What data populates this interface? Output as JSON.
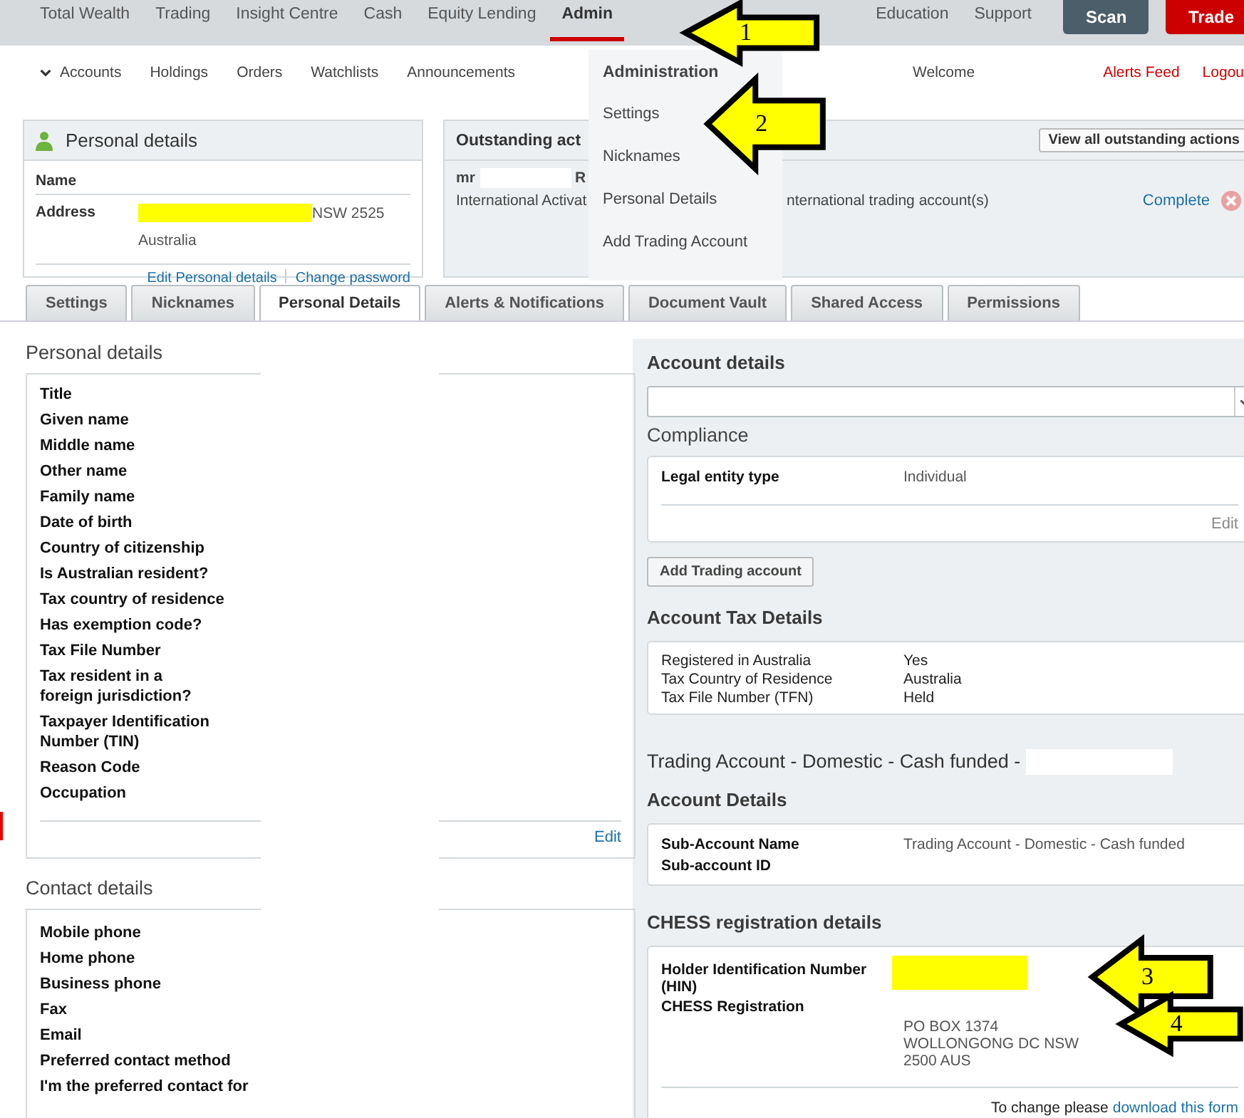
{
  "top_nav": {
    "items": [
      {
        "label": "Total Wealth",
        "selected": false
      },
      {
        "label": "Trading",
        "selected": false
      },
      {
        "label": "Insight Centre",
        "selected": false
      },
      {
        "label": "Cash",
        "selected": false
      },
      {
        "label": "Equity Lending",
        "selected": false
      },
      {
        "label": "Admin",
        "selected": true
      }
    ],
    "right_items": [
      "Education",
      "Support"
    ],
    "buttons": [
      {
        "label": "Scan",
        "kind": "scan"
      },
      {
        "label": "Trade",
        "kind": "trade"
      }
    ]
  },
  "sub_nav": {
    "items": [
      {
        "label": "Accounts",
        "kind": "dropdown"
      },
      {
        "label": "Holdings",
        "kind": "link"
      },
      {
        "label": "Orders",
        "kind": "link"
      },
      {
        "label": "Watchlists",
        "kind": "link"
      },
      {
        "label": "Announcements",
        "kind": "link"
      }
    ],
    "welcome": "Welcome",
    "links": [
      "Alerts Feed",
      "Logou"
    ]
  },
  "admin_menu": {
    "heading": "Administration",
    "items": [
      "Settings",
      "Nicknames",
      "Personal Details",
      "Add Trading Account"
    ]
  },
  "personal_card": {
    "title": "Personal details",
    "rows": [
      {
        "label": "Name"
      },
      {
        "label": "Address",
        "redacted": true,
        "value_lines": [
          "NSW 2525",
          "Australia"
        ]
      }
    ],
    "links": [
      "Edit Personal details",
      "Change password"
    ]
  },
  "outstanding_card": {
    "title": "Outstanding act",
    "button": "View all outstanding actions",
    "action": {
      "name": "mr",
      "redacted": true,
      "name_tail": "R",
      "type": "International Activat",
      "description": "nternational trading account(s)",
      "status": "Complete"
    }
  },
  "tabs": [
    {
      "label": "Settings",
      "selected": false
    },
    {
      "label": "Nicknames",
      "selected": false
    },
    {
      "label": "Personal Details",
      "selected": true
    },
    {
      "label": "Alerts & Notifications",
      "selected": false
    },
    {
      "label": "Document Vault",
      "selected": false
    },
    {
      "label": "Shared Access",
      "selected": false
    },
    {
      "label": "Permissions",
      "selected": false
    }
  ],
  "personal_details": {
    "title": "Personal details",
    "values_redacted": true,
    "fields": [
      "Title",
      "Given name",
      "Middle name",
      "Other name",
      "Family name",
      "Date of birth",
      "Country of citizenship",
      "Is Australian resident?",
      "Tax country of residence",
      "Has exemption code?",
      "Tax File Number",
      "Tax resident in a\nforeign jurisdiction?",
      "Taxpayer Identification\nNumber (TIN)",
      "Reason Code",
      "Occupation"
    ],
    "edit": "Edit"
  },
  "contact_details": {
    "title": "Contact details",
    "fields": [
      "Mobile phone",
      "Home phone",
      "Business phone",
      "Fax",
      "Email",
      "Preferred contact method",
      "I'm the preferred contact for"
    ]
  },
  "account_details": {
    "title": "Account details",
    "compliance": {
      "title": "Compliance",
      "rows": [
        {
          "label": "Legal entity type",
          "value": "Individual"
        }
      ],
      "edit": "Edit"
    },
    "add_button": "Add Trading account",
    "tax": {
      "title": "Account Tax Details",
      "rows": [
        {
          "label": "Registered in Australia",
          "value": "Yes"
        },
        {
          "label": "Tax Country of Residence",
          "value": "Australia"
        },
        {
          "label": "Tax File Number (TFN)",
          "value": "Held"
        }
      ]
    },
    "trading": {
      "title": "Trading Account - Domestic - Cash funded -",
      "redacted": true
    },
    "sub_account": {
      "title": "Account Details",
      "rows": [
        {
          "label": "Sub-Account Name",
          "value_lines": [
            "Trading Account - Domestic - Cash funded"
          ]
        },
        {
          "label": "Sub-account ID"
        }
      ]
    },
    "chess": {
      "title": "CHESS registration details",
      "rows": [
        {
          "label": "Holder Identification Number\n(HIN)",
          "redacted": true
        },
        {
          "label": "CHESS Registration",
          "value_lines": [
            "PO BOX 1374",
            "WOLLONGONG DC NSW",
            "2500 AUS"
          ]
        }
      ],
      "note": "To change please",
      "link": "download this form"
    }
  },
  "annotations": [
    {
      "label": "1"
    },
    {
      "label": "2"
    },
    {
      "label": "3"
    },
    {
      "label": "4"
    }
  ]
}
